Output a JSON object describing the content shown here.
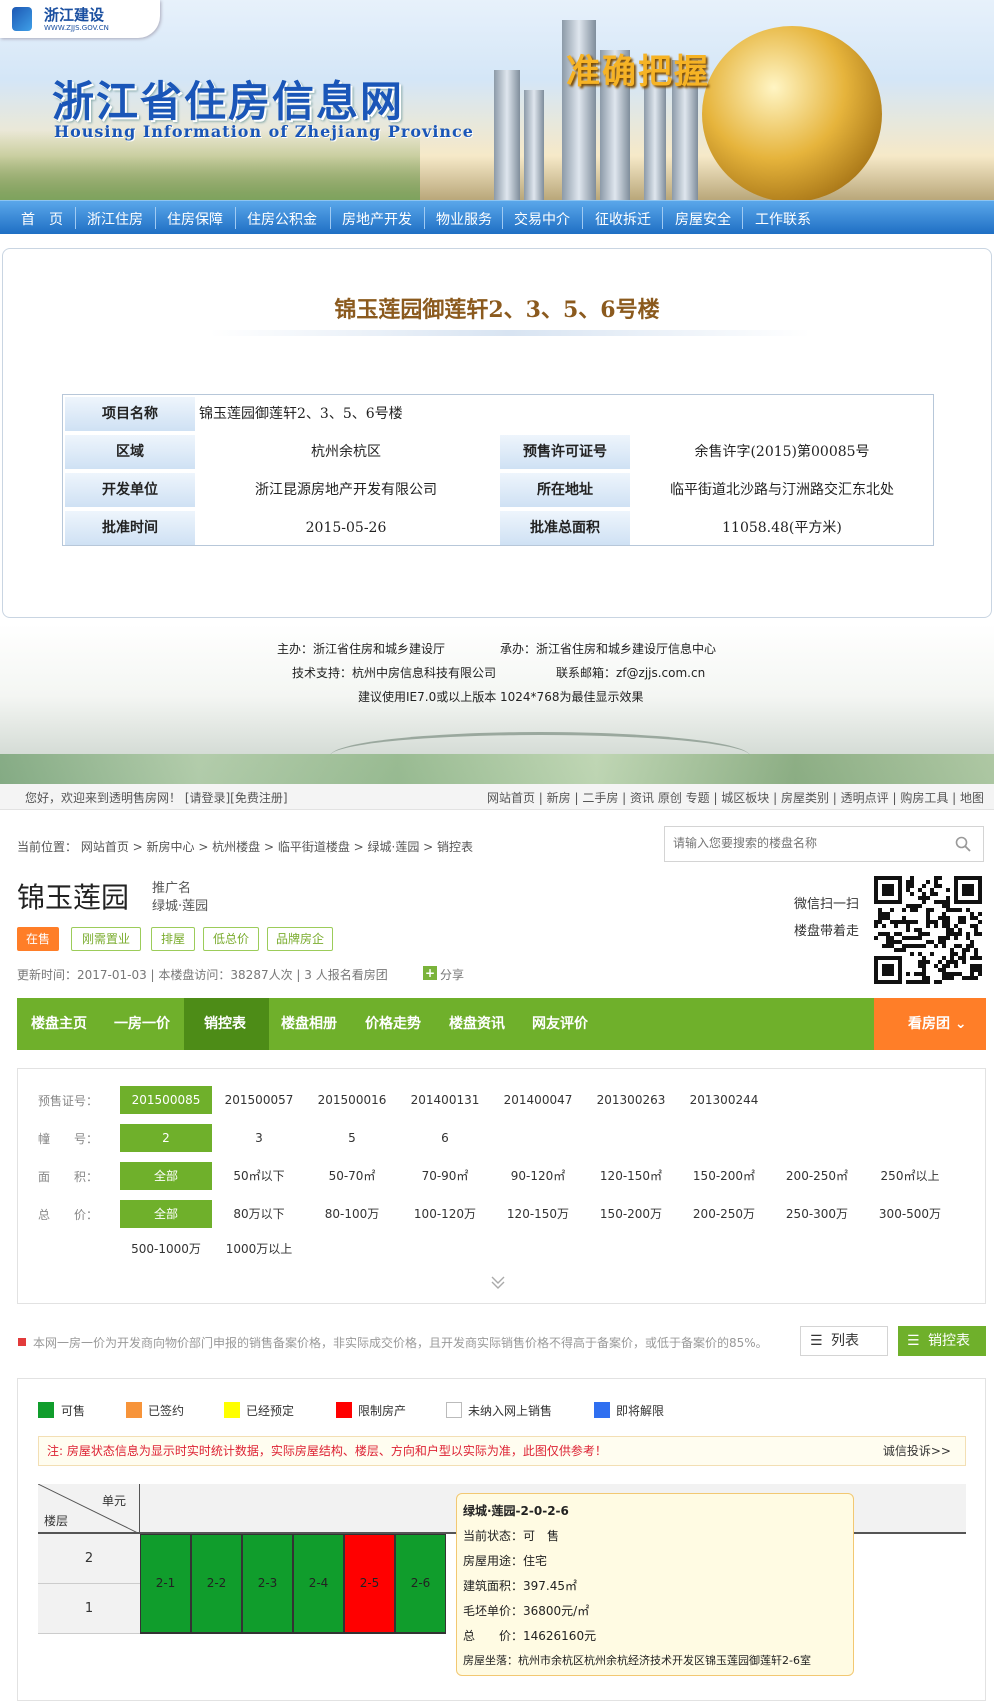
{
  "gov_site": {
    "logo_name": "浙江建设",
    "logo_url": "WWW.ZJJS.GOV.CN",
    "title": "浙江省住房信息网",
    "subtitle": "Housing Information of Zhejiang Province",
    "slogan": "准确把握",
    "nav": [
      "首　页",
      "浙江住房",
      "住房保障",
      "住房公积金",
      "房地产开发",
      "物业服务",
      "交易中介",
      "征收拆迁",
      "房屋安全",
      "工作联系"
    ],
    "project": {
      "title": "锦玉莲园御莲轩2、3、5、6号楼",
      "fields": {
        "name_key": "项目名称",
        "name_val": "锦玉莲园御莲轩2、3、5、6号楼",
        "area_key": "区域",
        "area_val": "杭州余杭区",
        "permit_key": "预售许可证号",
        "permit_val": "余售许字(2015)第00085号",
        "dev_key": "开发单位",
        "dev_val": "浙江昆源房地产开发有限公司",
        "addr_key": "所在地址",
        "addr_val": "临平街道北沙路与汀洲路交汇东北处",
        "date_key": "批准时间",
        "date_val": "2015-05-26",
        "size_key": "批准总面积",
        "size_val": "11058.48(平方米)"
      }
    },
    "footer": {
      "host": "主办：浙江省住房和城乡建设厅",
      "organizer": "承办：浙江省住房和城乡建设厅信息中心",
      "tech": "技术支持：杭州中房信息科技有限公司",
      "email": "联系邮箱：zf@zjjs.com.cn",
      "browser": "建议使用IE7.0或以上版本 1024*768为最佳显示效果"
    }
  },
  "estate_site": {
    "topbar": {
      "welcome": "您好，欢迎来到透明售房网！ [请登录][免费注册]",
      "links": "网站首页 | 新房 | 二手房 | 资讯 原创 专题 | 城区板块 | 房屋类别 | 透明点评 | 购房工具 | 地图"
    },
    "breadcrumb": "当前位置： 网站首页 > 新房中心 > 杭州楼盘 > 临平街道楼盘 > 绿城·莲园 > 销控表",
    "search_placeholder": "请输入您要搜索的楼盘名称",
    "estate_name": "锦玉莲园",
    "promo_label": "推广名",
    "promo_name": "绿城·莲园",
    "wechat_line1": "微信扫一扫",
    "wechat_line2": "楼盘带着走",
    "tags": [
      "在售",
      "刚需置业",
      "排屋",
      "低总价",
      "品牌房企"
    ],
    "meta": "更新时间：2017-01-03 | 本楼盘访问：38287人次 | 3 人报名看房团",
    "share": "分享",
    "green_nav": [
      "楼盘主页",
      "一房一价",
      "销控表",
      "楼盘相册",
      "价格走势",
      "楼盘资讯",
      "网友评价"
    ],
    "tour": "看房团",
    "filters": {
      "permit_label": "预售证号：",
      "permits": [
        "201500085",
        "201500057",
        "201500016",
        "201400131",
        "201400047",
        "201300263",
        "201300244"
      ],
      "building_label": "幢　　号：",
      "buildings": [
        "2",
        "3",
        "5",
        "6"
      ],
      "area_label": "面　　积：",
      "areas": [
        "全部",
        "50㎡以下",
        "50-70㎡",
        "70-90㎡",
        "90-120㎡",
        "120-150㎡",
        "150-200㎡",
        "200-250㎡",
        "250㎡以上"
      ],
      "price_label": "总　　价：",
      "prices": [
        "全部",
        "80万以下",
        "80-100万",
        "100-120万",
        "120-150万",
        "150-200万",
        "200-250万",
        "250-300万",
        "300-500万",
        "500-1000万",
        "1000万以上"
      ]
    },
    "notice": "本网一房一价为开发商向物价部门申报的销售备案价格，非实际成交价格，且开发商实际销售价格不得高于备案价，或低于备案价的85%。",
    "view_list": "列表",
    "view_table": "销控表",
    "legend": [
      {
        "label": "可售",
        "color": "#109d2c"
      },
      {
        "label": "已签约",
        "color": "#f7943a"
      },
      {
        "label": "已经预定",
        "color": "#ffff00"
      },
      {
        "label": "限制房产",
        "color": "#ff0000"
      },
      {
        "label": "未纳入网上销售",
        "color": "#ffffff"
      },
      {
        "label": "即将解限",
        "color": "#2f6ff0"
      }
    ],
    "warning": "注: 房屋状态信息为显示时实时统计数据，实际房屋结构、楼层、方向和户型以实际为准，此图仅供参考！",
    "warning_link": "诚信投诉>>",
    "table": {
      "unit_label": "单元",
      "floor_label": "楼层",
      "unit_col": "0",
      "floors": [
        "2",
        "1"
      ],
      "units": [
        {
          "label": "2-1",
          "color": "#109d2c"
        },
        {
          "label": "2-2",
          "color": "#109d2c"
        },
        {
          "label": "2-3",
          "color": "#109d2c"
        },
        {
          "label": "2-4",
          "color": "#109d2c"
        },
        {
          "label": "2-5",
          "color": "#ff0000"
        },
        {
          "label": "2-6",
          "color": "#109d2c"
        }
      ]
    },
    "tooltip": {
      "title": "绿城·莲园-2-0-2-6",
      "status": "当前状态：可　售",
      "usage": "房屋用途：住宅",
      "area": "建筑面积：397.45㎡",
      "unit_price": "毛坯单价：36800元/㎡",
      "total": "总　　价：14626160元",
      "location": "房屋坐落：杭州市余杭区杭州余杭经济技术开发区锦玉莲园御莲轩2-6室"
    }
  }
}
